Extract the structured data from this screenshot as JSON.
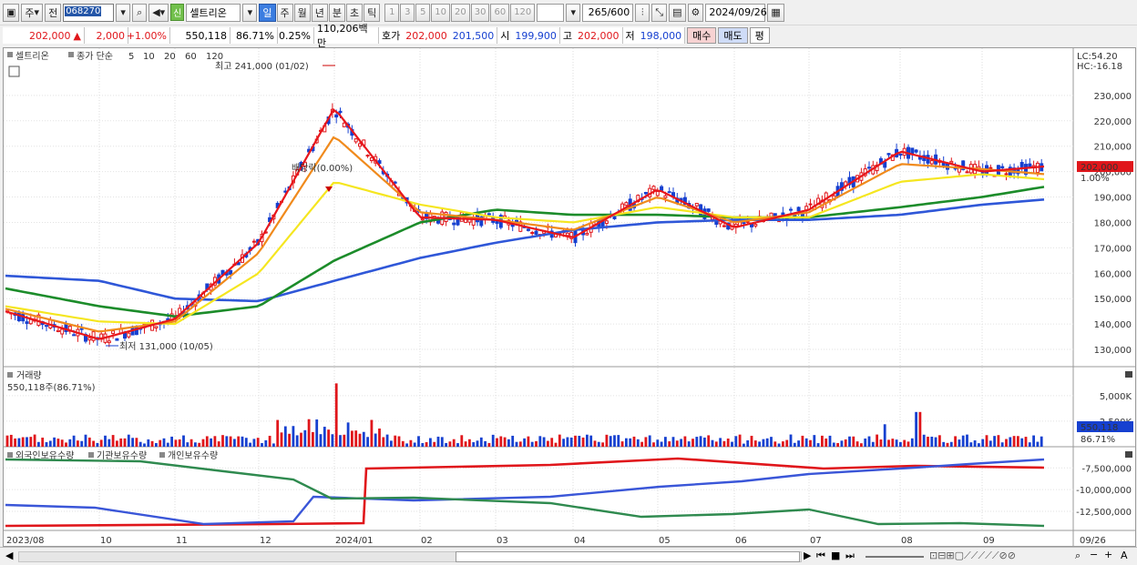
{
  "toolbar": {
    "market_sel": "주",
    "mode_btn": "전",
    "code": "068270",
    "badge": "신",
    "name": "셀트리온",
    "periods": [
      "일",
      "주",
      "월",
      "년",
      "분",
      "초",
      "틱"
    ],
    "selected_period": "일",
    "intervals": [
      "1",
      "3",
      "5",
      "10",
      "20",
      "30",
      "60",
      "120"
    ],
    "count": "265",
    "count_max": "/600",
    "date": "2024/09/26"
  },
  "quote": {
    "price": "202,000",
    "change_symbol": "▲",
    "change": "2,000",
    "change_pct": "+1.00%",
    "volume": "550,118",
    "vol_ratio": "86.71%",
    "turnover": "0.25%",
    "amount": "110,206백만",
    "hoga_label": "호가",
    "ask": "202,000",
    "bid": "201,500",
    "open_label": "시",
    "open": "199,900",
    "high_label": "고",
    "high": "202,000",
    "low_label": "저",
    "low": "198,000",
    "buy": "매수",
    "sell": "매도",
    "eval": "평"
  },
  "price_panel": {
    "stock_name": "셀트리온",
    "legend_prefix": "종가 단순",
    "ma_periods": [
      "5",
      "10",
      "20",
      "60",
      "120"
    ],
    "lc": "LC:54.20",
    "hc": "HC:-16.18",
    "y_ticks": [
      "230,000",
      "220,000",
      "210,000",
      "200,000",
      "190,000",
      "180,000",
      "170,000",
      "160,000",
      "150,000",
      "140,000",
      "130,000"
    ],
    "current_price_tag": "202,000",
    "current_pct_tag": "1.00%",
    "annotation_high": "최고 241,000 (01/02)",
    "annotation_low": "최저 131,000 (10/05)",
    "annotation_div": "배당락(0.00%)"
  },
  "volume_panel": {
    "title": "거래량",
    "readout": "550,118주(86.71%)",
    "y_ticks": [
      "5,000K",
      "2,500K"
    ],
    "current_tag": "550,118",
    "pct_tag": "86.71%"
  },
  "holding_panel": {
    "legend": [
      "외국인보유수량",
      "기관보유수량",
      "개인보유수량"
    ],
    "y_ticks": [
      "-7,500,000",
      "-10,000,000",
      "-12,500,000"
    ]
  },
  "x_axis": [
    "2023/08",
    "10",
    "11",
    "12",
    "2024/01",
    "02",
    "03",
    "04",
    "05",
    "06",
    "07",
    "08",
    "09",
    "09/26"
  ],
  "colors": {
    "ma5": "#e8161b",
    "ma10": "#f08a1c",
    "ma20": "#f5e620",
    "ma60": "#1c8c2a",
    "ma120": "#2f57d8",
    "up": "#e0161b",
    "down": "#1640d0",
    "foreign": "#e0161b",
    "institution": "#3a56d8",
    "individual": "#2f8a4f"
  },
  "chart_data": {
    "type": "line",
    "title": "",
    "x": [
      "2023/08",
      "10",
      "11",
      "12",
      "2024/01",
      "02",
      "03",
      "04",
      "05",
      "06",
      "07",
      "08",
      "09",
      "09/26"
    ],
    "series": [
      {
        "name": "5",
        "values": [
          145000,
          134000,
          142000,
          172000,
          225000,
          182000,
          181000,
          174000,
          193000,
          178000,
          185000,
          208000,
          200000,
          202000
        ]
      },
      {
        "name": "10",
        "values": [
          146000,
          137000,
          141000,
          168000,
          214000,
          184000,
          181000,
          177000,
          190000,
          180000,
          184000,
          203000,
          201000,
          199000
        ]
      },
      {
        "name": "20",
        "values": [
          147000,
          141000,
          140000,
          160000,
          196000,
          187000,
          182000,
          180000,
          186000,
          182000,
          182000,
          196000,
          199000,
          197000
        ]
      },
      {
        "name": "60",
        "values": [
          154000,
          147000,
          143000,
          147000,
          165000,
          180000,
          185000,
          183000,
          183000,
          182000,
          182000,
          186000,
          190000,
          194000
        ]
      },
      {
        "name": "120",
        "values": [
          159000,
          157000,
          150000,
          149000,
          157000,
          166000,
          172000,
          177000,
          180000,
          181000,
          181000,
          183000,
          187000,
          189000
        ]
      }
    ],
    "ylim": [
      125000,
      245000
    ]
  }
}
